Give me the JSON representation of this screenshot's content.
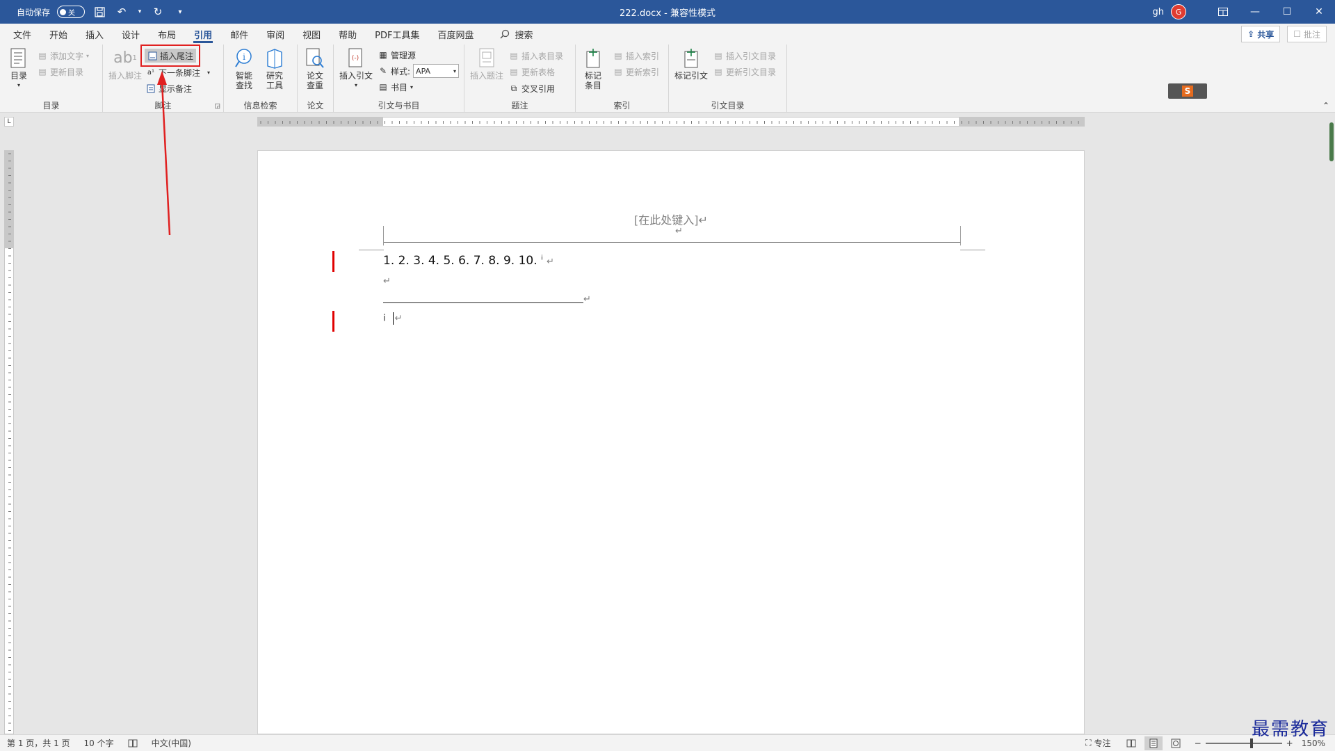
{
  "titlebar": {
    "autosave_label": "自动保存",
    "autosave_state": "关",
    "doc_title": "222.docx  -  兼容性模式",
    "user_name": "gh",
    "avatar_letter": "G",
    "accent_color": "#2b579a"
  },
  "menu": {
    "tabs": [
      "文件",
      "开始",
      "插入",
      "设计",
      "布局",
      "引用",
      "邮件",
      "审阅",
      "视图",
      "帮助",
      "PDF工具集",
      "百度网盘"
    ],
    "active_tab": "引用",
    "search_label": "搜索",
    "share_label": "共享",
    "comment_label": "批注"
  },
  "ribbon": {
    "toc": {
      "group_label": "目录",
      "toc_button": "目录",
      "add_text": "添加文字",
      "update_toc": "更新目录"
    },
    "footnotes": {
      "group_label": "脚注",
      "insert_footnote": "插入脚注",
      "insert_endnote": "插入尾注",
      "next_footnote": "下一条脚注",
      "show_notes": "显示备注"
    },
    "research": {
      "group_label": "信息检索",
      "smart_lookup_1": "智能",
      "smart_lookup_2": "查找",
      "research_tool_1": "研究",
      "research_tool_2": "工具"
    },
    "paper": {
      "group_label": "论文",
      "check_1": "论文",
      "check_2": "查重"
    },
    "citations": {
      "group_label": "引文与书目",
      "insert_citation": "插入引文",
      "manage_sources": "管理源",
      "style_label": "样式:",
      "style_value": "APA",
      "bibliography": "书目"
    },
    "captions": {
      "group_label": "题注",
      "insert_caption": "插入题注",
      "insert_table_of_figures": "插入表目录",
      "update_table": "更新表格",
      "cross_reference": "交叉引用"
    },
    "index": {
      "group_label": "索引",
      "mark_entry_1": "标记",
      "mark_entry_2": "条目",
      "insert_index": "插入索引",
      "update_index": "更新索引"
    },
    "authorities": {
      "group_label": "引文目录",
      "mark_citation": "标记引文",
      "insert_table_of_authorities": "插入引文目录",
      "update_table_of_authorities": "更新引文目录"
    }
  },
  "document": {
    "header_placeholder": "[在此处键入]↵",
    "header_para_mark": "↵",
    "line1_text": "1. 2. 3. 4. 5. 6. 7. 8. 9. 10.",
    "line1_sup": "i",
    "para_mark": "↵",
    "endnote_ref": "i"
  },
  "statusbar": {
    "page_info": "第 1 页，共 1 页",
    "word_count": "10 个字",
    "language": "中文(中国)",
    "focus_label": "专注",
    "zoom_level": "150%",
    "zoom_minus": "−",
    "zoom_plus": "+"
  },
  "watermark": {
    "text": "最需教育"
  }
}
